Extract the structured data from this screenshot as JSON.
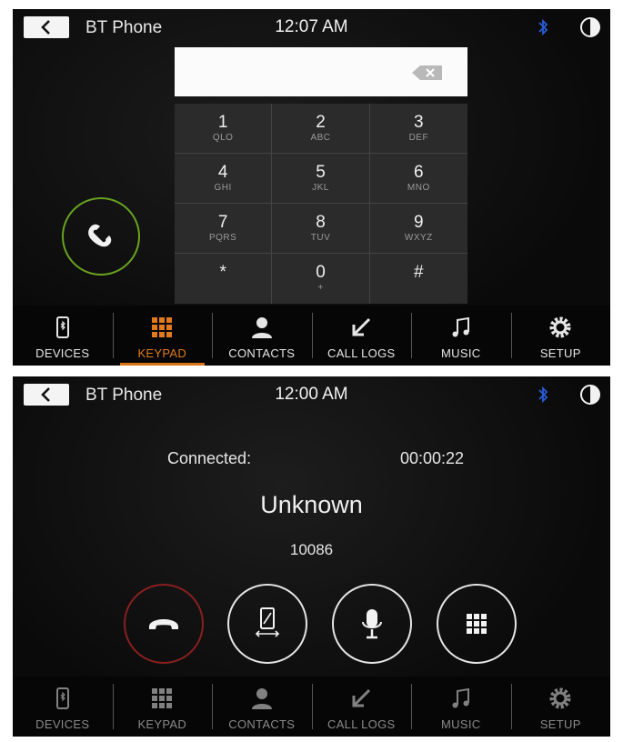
{
  "screen_keypad": {
    "header": {
      "app_title": "BT Phone",
      "time": "12:07 AM"
    },
    "dial_input": {
      "value": ""
    },
    "keys": [
      {
        "digit": "1",
        "letters": "QLO"
      },
      {
        "digit": "2",
        "letters": "ABC"
      },
      {
        "digit": "3",
        "letters": "DEF"
      },
      {
        "digit": "4",
        "letters": "GHI"
      },
      {
        "digit": "5",
        "letters": "JKL"
      },
      {
        "digit": "6",
        "letters": "MNO"
      },
      {
        "digit": "7",
        "letters": "PQRS"
      },
      {
        "digit": "8",
        "letters": "TUV"
      },
      {
        "digit": "9",
        "letters": "WXYZ"
      },
      {
        "digit": "*",
        "letters": ""
      },
      {
        "digit": "0",
        "letters": "+"
      },
      {
        "digit": "#",
        "letters": ""
      }
    ],
    "nav": {
      "active": "KEYPAD",
      "items": [
        "DEVICES",
        "KEYPAD",
        "CONTACTS",
        "CALL LOGS",
        "MUSIC",
        "SETUP"
      ]
    }
  },
  "screen_call": {
    "header": {
      "app_title": "BT Phone",
      "time": "12:00 AM"
    },
    "status_label": "Connected:",
    "duration": "00:00:22",
    "caller_name": "Unknown",
    "caller_number": "10086",
    "nav": {
      "items": [
        "DEVICES",
        "KEYPAD",
        "CONTACTS",
        "CALL LOGS",
        "MUSIC",
        "SETUP"
      ]
    }
  },
  "colors": {
    "accent_active": "#e07a1a",
    "call_green": "#6aa320",
    "end_call_red": "#8a1f1f",
    "bluetooth_blue": "#2a5bd7",
    "background": "#0b0b0b"
  },
  "icons": {
    "header": [
      "back-arrow-icon",
      "bluetooth-icon",
      "brightness-icon"
    ],
    "nav": [
      "phone-device-icon",
      "keypad-grid-icon",
      "contact-person-icon",
      "call-log-arrow-icon",
      "music-note-icon",
      "gear-icon"
    ],
    "call_controls": [
      "end-call-icon",
      "transfer-to-phone-icon",
      "microphone-icon",
      "keypad-grid-icon"
    ]
  }
}
